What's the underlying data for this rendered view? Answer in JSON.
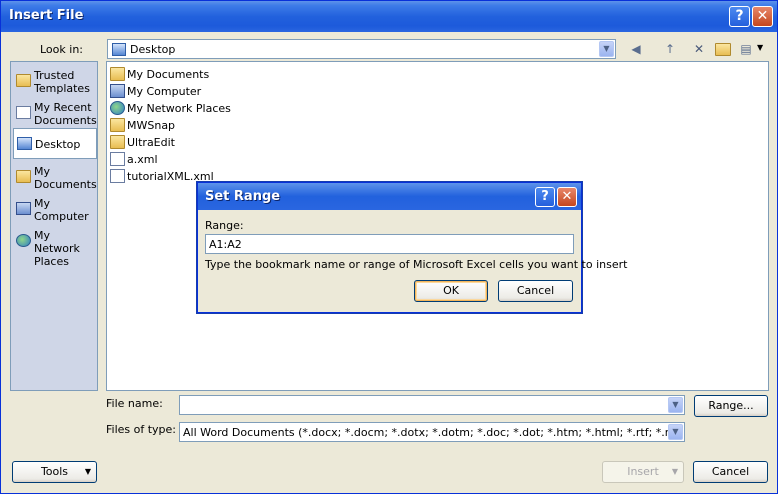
{
  "window": {
    "title": "Insert File",
    "help_glyph": "?",
    "close_glyph": "✕"
  },
  "look_in": {
    "label": "Look in:",
    "value": "Desktop"
  },
  "toolbar": {
    "back_glyph": "◀",
    "up_glyph": "↑",
    "delete_glyph": "✕",
    "views_glyph": "▤"
  },
  "places": [
    {
      "label_line1": "Trusted",
      "label_line2": "Templates",
      "icon": "folder-icon"
    },
    {
      "label_line1": "My Recent",
      "label_line2": "Documents",
      "icon": "recent-documents-icon"
    },
    {
      "label_line1": "Desktop",
      "label_line2": "",
      "icon": "desktop-icon"
    },
    {
      "label_line1": "My",
      "label_line2": "Documents",
      "icon": "my-documents-icon"
    },
    {
      "label_line1": "My",
      "label_line2": "Computer",
      "icon": "computer-icon"
    },
    {
      "label_line1": "My Network",
      "label_line2": "Places",
      "icon": "network-icon"
    }
  ],
  "files": [
    {
      "name": "My Documents",
      "icon": "my-documents-icon"
    },
    {
      "name": "My Computer",
      "icon": "computer-icon"
    },
    {
      "name": "My Network Places",
      "icon": "network-icon"
    },
    {
      "name": "MWSnap",
      "icon": "folder-icon"
    },
    {
      "name": "UltraEdit",
      "icon": "folder-icon"
    },
    {
      "name": "a.xml",
      "icon": "xml-file-icon"
    },
    {
      "name": "tutorialXML.xml",
      "icon": "xml-file-icon"
    }
  ],
  "file_name": {
    "label": "File name:",
    "value": ""
  },
  "files_of_type": {
    "label": "Files of type:",
    "value": "All Word Documents (*.docx; *.docm; *.dotx; *.dotm; *.doc; *.dot; *.htm; *.html; *.rtf; *.mht; *.m"
  },
  "buttons": {
    "range": "Range...",
    "tools": "Tools",
    "insert": "Insert",
    "cancel": "Cancel"
  },
  "set_range_dialog": {
    "title": "Set Range",
    "range_label": "Range:",
    "range_value": "A1:A2",
    "hint": "Type the bookmark name or range of Microsoft Excel cells you want to insert",
    "ok": "OK",
    "cancel": "Cancel"
  }
}
